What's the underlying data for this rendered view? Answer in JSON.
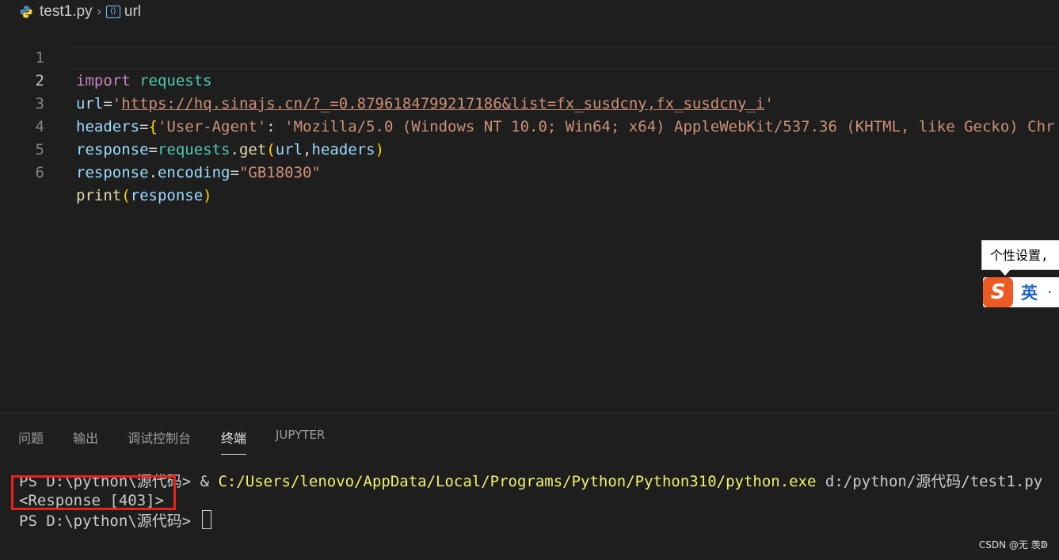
{
  "breadcrumb": {
    "file": "test1.py",
    "symbol": "url"
  },
  "editor": {
    "lines": [
      {
        "num": "1"
      },
      {
        "num": "2"
      },
      {
        "num": "3"
      },
      {
        "num": "4"
      },
      {
        "num": "5"
      },
      {
        "num": "6"
      }
    ],
    "tokens": {
      "l1_import": "import",
      "l1_module": "requests",
      "l2_var": "url",
      "l2_eq": "=",
      "l2_q1": "'",
      "l2_url": "https://hq.sinajs.cn/?_=0.8796184799217186&list=fx_susdcny,fx_susdcny_i",
      "l2_q2": "'",
      "l3_var": "headers",
      "l3_eq": "=",
      "l3_brace": "{",
      "l3_key": "'User-Agent'",
      "l3_colon": ": ",
      "l3_value": "'Mozilla/5.0 (Windows NT 10.0; Win64; x64) AppleWebKit/537.36 (KHTML, like Gecko) Chr",
      "l4_var": "response",
      "l4_eq": "=",
      "l4_mod": "requests",
      "l4_dot": ".",
      "l4_fn": "get",
      "l4_open": "(",
      "l4_arg1": "url",
      "l4_comma": ",",
      "l4_arg2": "headers",
      "l4_close": ")",
      "l5_var": "response",
      "l5_dot": ".",
      "l5_attr": "encoding",
      "l5_eq": "=",
      "l5_str": "\"GB18030\"",
      "l6_fn": "print",
      "l6_open": "(",
      "l6_arg": "response",
      "l6_close": ")"
    }
  },
  "ime": {
    "tip": "个性设置,",
    "logo": "S",
    "lang": "英",
    "dot": "·"
  },
  "panel": {
    "tabs": [
      {
        "label": "问题"
      },
      {
        "label": "输出"
      },
      {
        "label": "调试控制台"
      },
      {
        "label": "终端",
        "active": true
      },
      {
        "label": "JUPYTER"
      }
    ]
  },
  "terminal": {
    "line1_prompt": "PS D:\\python\\源代码> ",
    "line1_amp": "& ",
    "line1_exe": "C:/Users/lenovo/AppData/Local/Programs/Python/Python310/python.exe",
    "line1_arg": " d:/python/源代码/test1.py",
    "line2": "<Response [403]>",
    "line3_prompt": "PS D:\\python\\源代码> "
  },
  "watermark": "CSDN @无 羡ↁ",
  "colors": {
    "background": "#1e1e1e",
    "highlight_box": "#e8231a",
    "keyword": "#c586c0",
    "string": "#ce9178",
    "terminal_path": "#f2f26b"
  }
}
